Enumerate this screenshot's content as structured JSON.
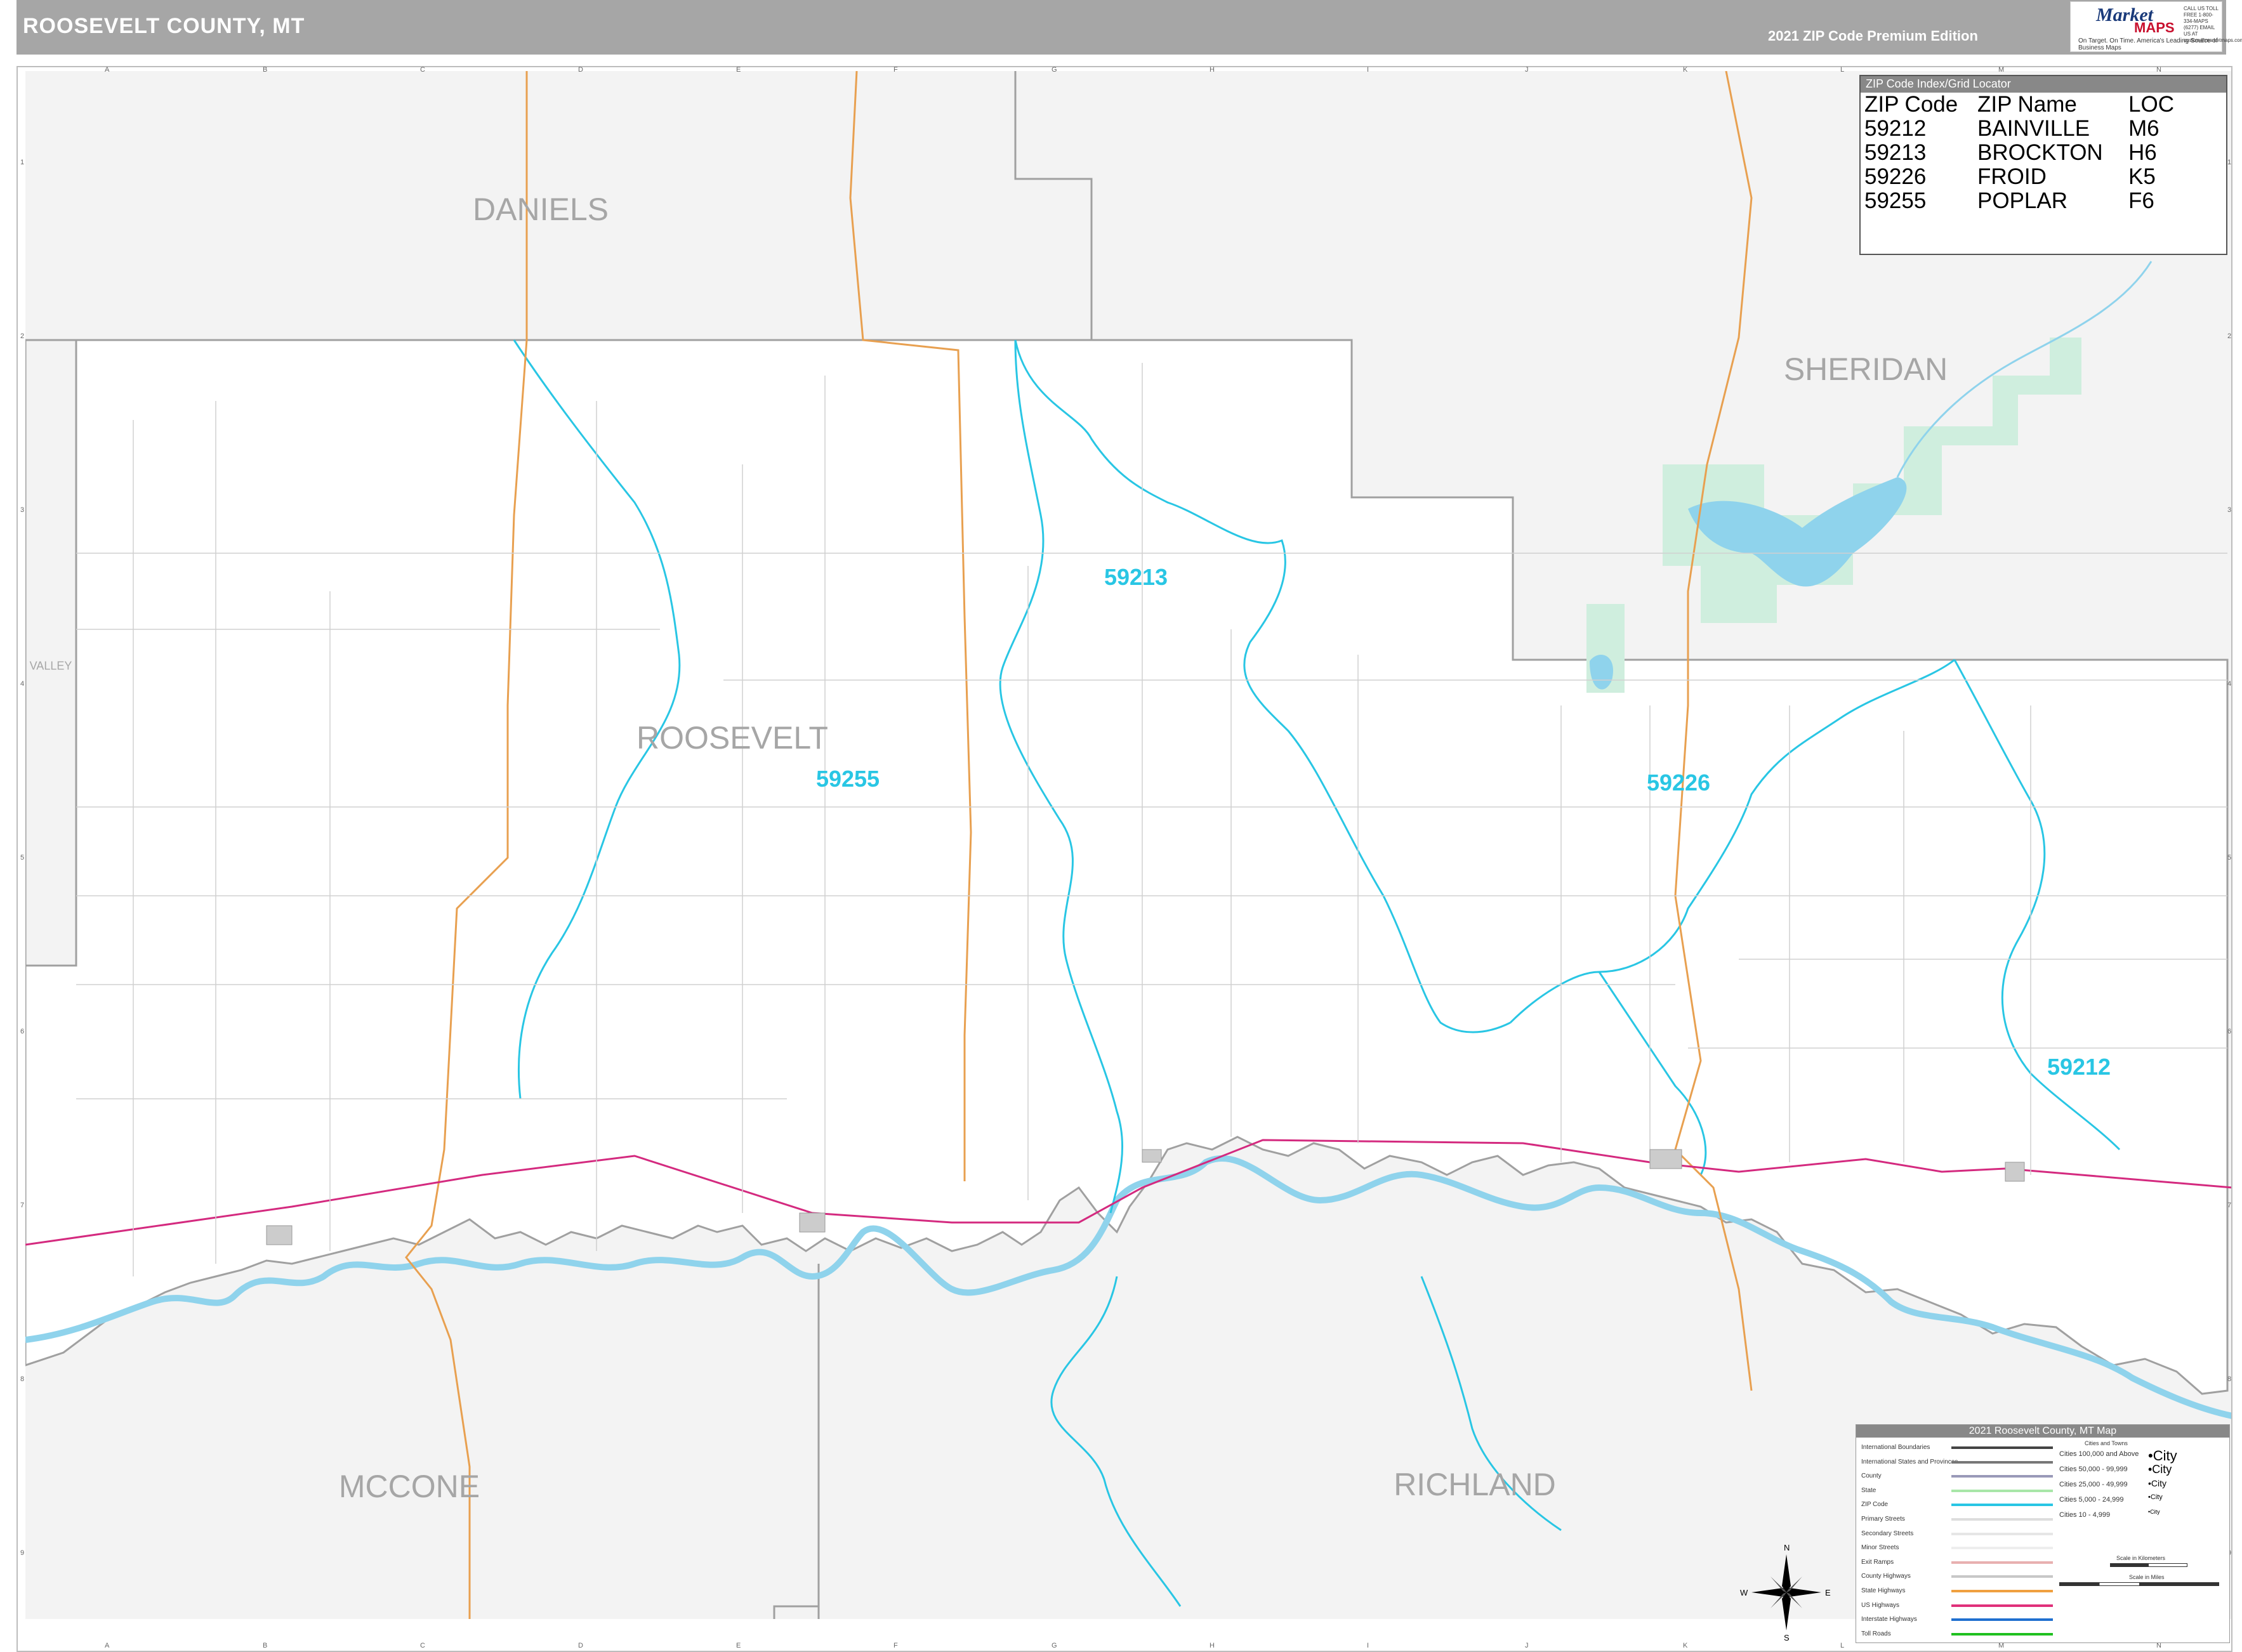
{
  "header": {
    "title": "ROOSEVELT COUNTY, MT",
    "edition": "2021 ZIP Code Premium Edition",
    "logo": {
      "brand_top": "Market",
      "brand_bottom": "MAPS",
      "tagline": "On Target.  On Time.",
      "subtagline": "America's Leading Source of Business Maps",
      "contact": "CALL US TOLL FREE 1-800-334-MAPS (6277) EMAIL US AT custom@marketmaps.com"
    }
  },
  "grid": {
    "columns": [
      "A",
      "B",
      "C",
      "D",
      "E",
      "F",
      "G",
      "H",
      "I",
      "J",
      "K",
      "L",
      "M",
      "N"
    ],
    "rows": [
      "1",
      "2",
      "3",
      "4",
      "5",
      "6",
      "7",
      "8",
      "9"
    ]
  },
  "zip_index": {
    "heading": "ZIP Code Index/Grid Locator",
    "columns": [
      "ZIP Code",
      "ZIP Name",
      "LOC"
    ],
    "rows": [
      [
        "59212",
        "BAINVILLE",
        "M6"
      ],
      [
        "59213",
        "BROCKTON",
        "H6"
      ],
      [
        "59226",
        "FROID",
        "K5"
      ],
      [
        "59255",
        "POPLAR",
        "F6"
      ]
    ]
  },
  "map_labels": {
    "counties": {
      "daniels": "DANIELS",
      "sheridan": "SHERIDAN",
      "roosevelt": "ROOSEVELT",
      "mccone": "MCCONE",
      "richland": "RICHLAND",
      "valley": "VALLEY"
    },
    "zips": {
      "z59213": "59213",
      "z59255": "59255",
      "z59226": "59226",
      "z59212": "59212"
    }
  },
  "legend": {
    "title": "2021 Roosevelt County, MT Map",
    "items": [
      {
        "label": "International Boundaries",
        "color": "#444444"
      },
      {
        "label": "International States and Provinces",
        "color": "#777777"
      },
      {
        "label": "County",
        "color": "#9a9ab8"
      },
      {
        "label": "State",
        "color": "#a8e6a8"
      },
      {
        "label": "ZIP Code",
        "color": "#29c6e4"
      },
      {
        "label": "Primary Streets",
        "color": "#dddddd"
      },
      {
        "label": "Secondary Streets",
        "color": "#e6e6e6"
      },
      {
        "label": "Minor Streets",
        "color": "#eeeeee"
      },
      {
        "label": "Exit Ramps",
        "color": "#e8b0b0"
      },
      {
        "label": "County Highways",
        "color": "#c8c8c8"
      },
      {
        "label": "State Highways",
        "color": "#f0a040"
      },
      {
        "label": "US Highways",
        "color": "#e0307a"
      },
      {
        "label": "Interstate Highways",
        "color": "#2070d0"
      },
      {
        "label": "Toll Roads",
        "color": "#20c020"
      }
    ],
    "cities_header": "Cities and Towns",
    "cities": [
      {
        "label": "Cities 100,000 and Above",
        "sample": "•City"
      },
      {
        "label": "Cities 50,000 - 99,999",
        "sample": "•City"
      },
      {
        "label": "Cities 25,000 - 49,999",
        "sample": "•City"
      },
      {
        "label": "Cities 5,000 - 24,999",
        "sample": "•City"
      },
      {
        "label": "Cities 10 - 4,999",
        "sample": "•City"
      }
    ],
    "scale_km": "Scale in Kilometers",
    "scale_mi": "Scale in Miles"
  },
  "compass": {
    "n": "N",
    "s": "S",
    "e": "E",
    "w": "W"
  },
  "colors": {
    "land_out": "#f3f3f3",
    "zip_line": "#29c6e4",
    "us_highway": "#d42a7f",
    "state_highway": "#e8a050",
    "water": "#8fd3ec",
    "park": "#cfeede",
    "county_line": "#a0a0a0"
  }
}
